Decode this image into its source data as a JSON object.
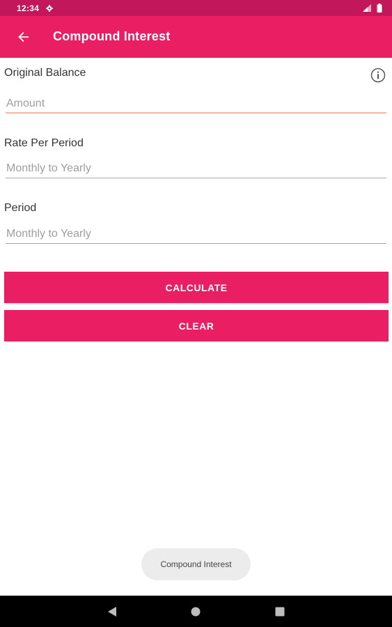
{
  "status_bar": {
    "time": "12:34",
    "icons": [
      "settings-icon",
      "signal-icon",
      "battery-icon"
    ]
  },
  "app_bar": {
    "title": "Compound Interest",
    "back_icon": "arrow-left-icon",
    "color": "#e91e63"
  },
  "form": {
    "original_balance": {
      "label": "Original Balance",
      "placeholder": "Amount",
      "value": ""
    },
    "rate_per_period": {
      "label": "Rate Per Period",
      "placeholder": "Monthly to Yearly",
      "value": ""
    },
    "period": {
      "label": "Period",
      "placeholder": "Monthly to Yearly",
      "value": ""
    },
    "info_icon": "info-icon"
  },
  "buttons": {
    "calculate_label": "CALCULATE",
    "clear_label": "CLEAR"
  },
  "toast": {
    "text": "Compound Interest"
  },
  "nav_bar": {
    "icons": [
      "back-triangle-icon",
      "home-circle-icon",
      "recents-square-icon"
    ]
  },
  "colors": {
    "status_bar": "#c2185b",
    "primary": "#e91e63",
    "focus_underline": "#f5b8a0"
  }
}
